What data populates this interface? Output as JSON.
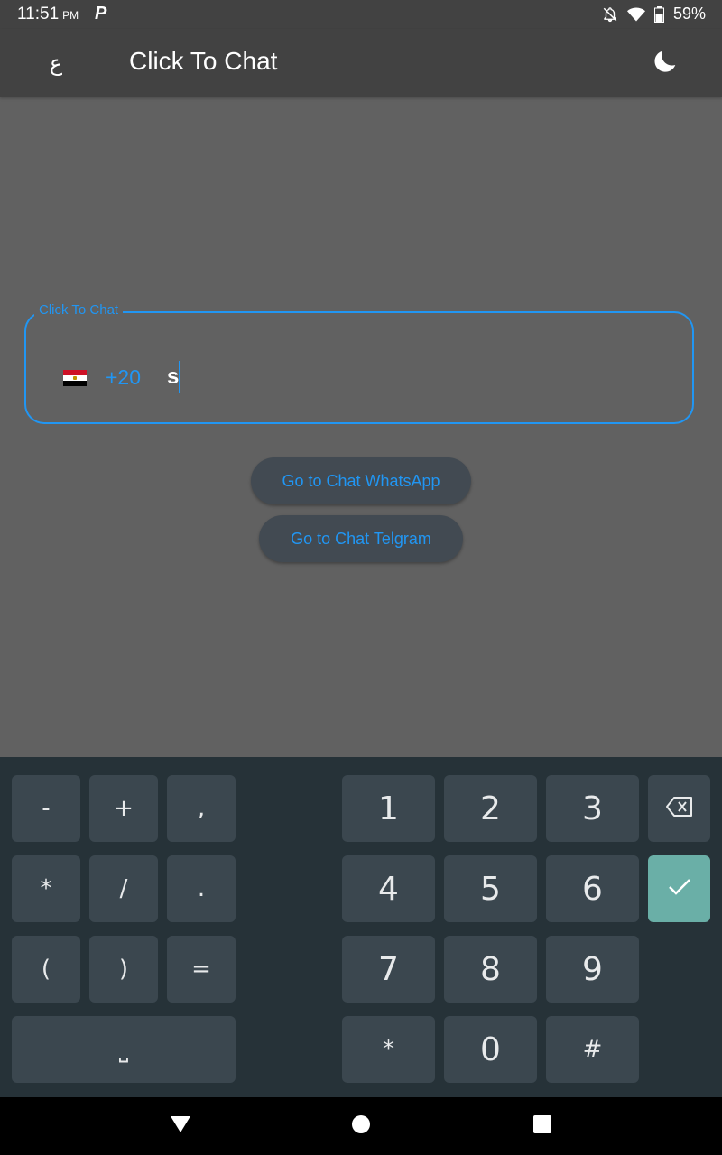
{
  "status": {
    "time": "11:51",
    "ampm": "PM",
    "app_icon": "P",
    "battery": "59%"
  },
  "app_bar": {
    "lang_label": "ع",
    "title": "Click To Chat",
    "theme_icon": "moon-icon"
  },
  "field": {
    "label": "Click To Chat",
    "dial_code": "+20",
    "value": "s",
    "country_flag_colors": [
      "#CE1126",
      "#FFFFFF",
      "#000000"
    ]
  },
  "buttons": {
    "whatsapp": "Go to Chat WhatsApp",
    "telegram": "Go to Chat Telgram"
  },
  "keyboard": {
    "symbols": [
      [
        "-",
        "+",
        ","
      ],
      [
        "*",
        "/",
        "."
      ],
      [
        "(",
        ")",
        "="
      ]
    ],
    "space_label": "⎵",
    "digits": [
      [
        "1",
        "2",
        "3"
      ],
      [
        "4",
        "5",
        "6"
      ],
      [
        "7",
        "8",
        "9"
      ],
      [
        "*",
        "0",
        "#"
      ]
    ],
    "backspace_icon": "backspace-icon",
    "enter_icon": "check-icon"
  },
  "colors": {
    "accent": "#2196F3",
    "enter_key": "#6aafa7"
  }
}
